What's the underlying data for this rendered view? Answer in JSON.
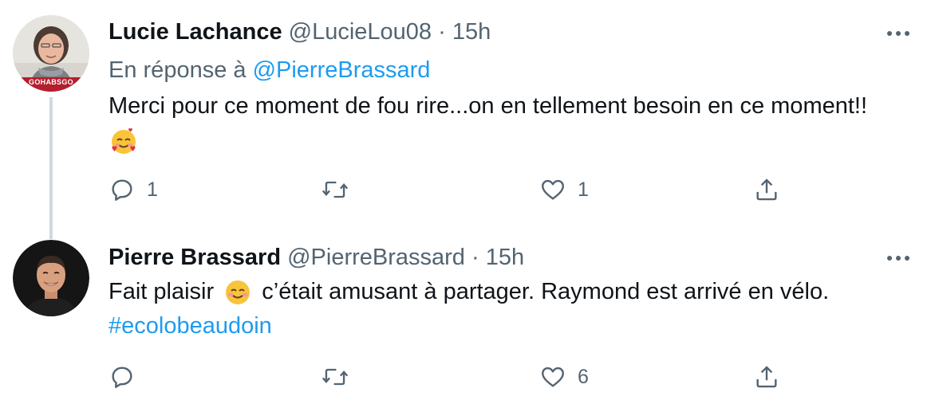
{
  "tweets": [
    {
      "author_name": "Lucie Lachance",
      "handle": "@LucieLou08",
      "separator": "·",
      "time": "15h",
      "avatar_badge": "GOHABSGO",
      "reply_prefix": "En réponse à",
      "reply_mention": "@PierreBrassard",
      "text": "Merci pour ce moment de fou rire...on en tellement besoin en ce moment!!",
      "emoji_after": "smiling-face-with-hearts",
      "reply_count": "1",
      "retweet_count": "",
      "like_count": "1"
    },
    {
      "author_name": "Pierre Brassard",
      "handle": "@PierreBrassard",
      "separator": "·",
      "time": "15h",
      "text_before_emoji": "Fait plaisir",
      "emoji_inline": "smiling-face-with-smiling-eyes",
      "text_after_emoji": "c’était amusant à partager. Raymond est arrivé en vélo.",
      "hashtag": "#ecolobeaudoin",
      "reply_count": "",
      "retweet_count": "",
      "like_count": "6"
    }
  ],
  "icons": {
    "reply": "speech-bubble-icon",
    "retweet": "retweet-arrows-icon",
    "like": "heart-outline-icon",
    "share": "share-upload-icon",
    "more": "more-dots-icon"
  },
  "colors": {
    "text": "#0f1419",
    "secondary": "#536471",
    "link": "#1d9bf0",
    "thread_line": "#cfd9de"
  }
}
